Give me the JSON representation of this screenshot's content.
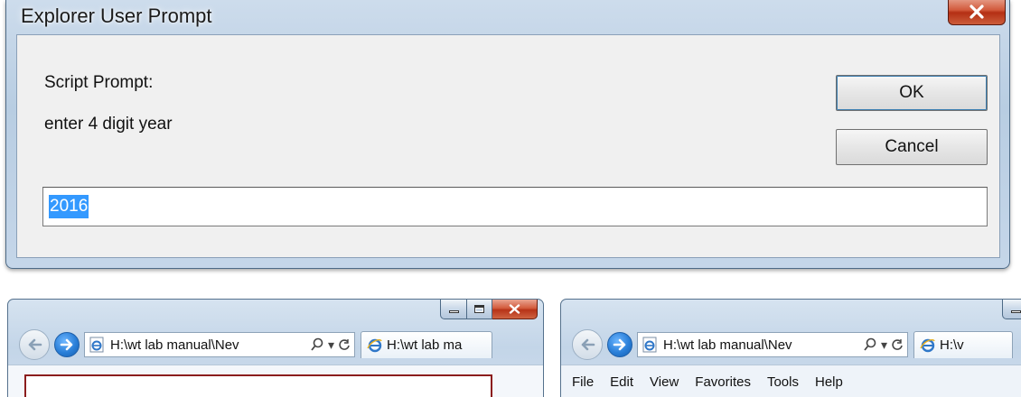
{
  "dialog": {
    "title": "Explorer User Prompt",
    "label_script_prompt": "Script Prompt:",
    "label_message": "enter 4 digit year",
    "ok_label": "OK",
    "cancel_label": "Cancel",
    "input_value": "2016"
  },
  "browser1": {
    "address": "H:\\wt lab manual\\Nev",
    "tab_title": "H:\\wt lab ma"
  },
  "browser2": {
    "address": "H:\\wt lab manual\\Nev",
    "tab_title": "H:\\v",
    "menu": [
      "File",
      "Edit",
      "View",
      "Favorites",
      "Tools",
      "Help"
    ]
  },
  "colors": {
    "selection": "#3399ff",
    "close_red": "#c7472a",
    "forward_blue": "#2a7fd8"
  }
}
